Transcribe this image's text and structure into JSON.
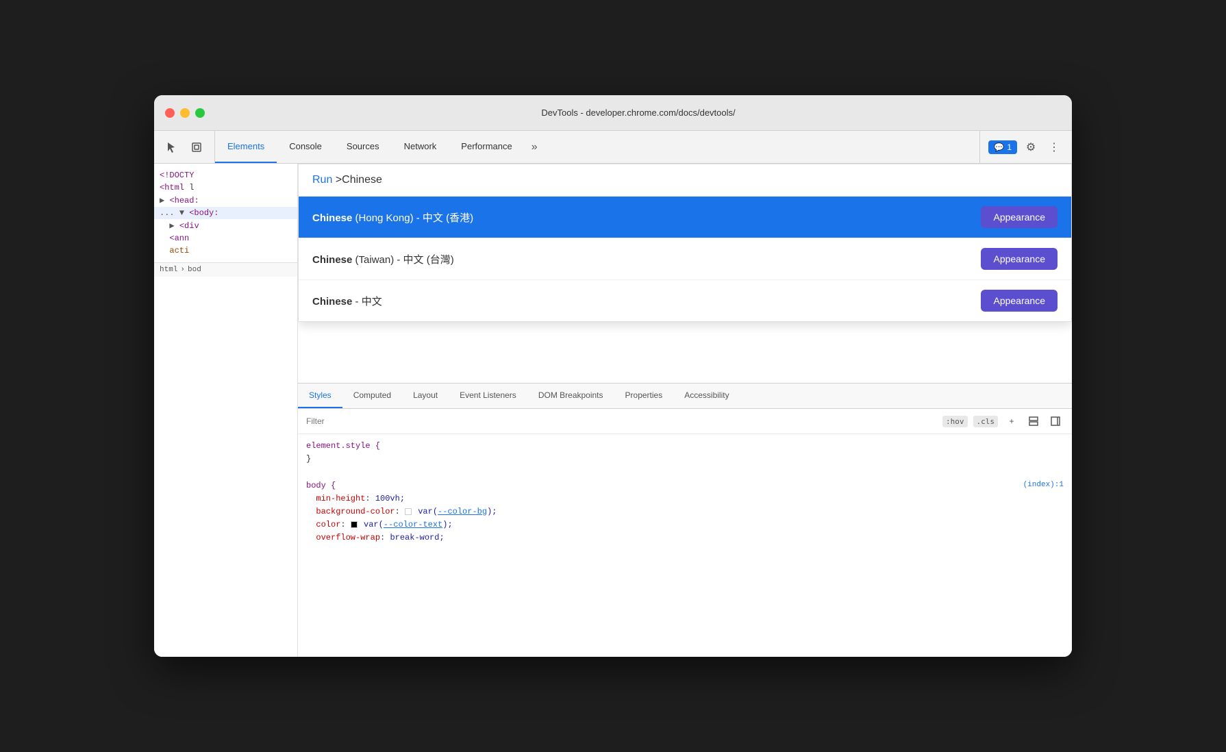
{
  "window": {
    "title": "DevTools - developer.chrome.com/docs/devtools/"
  },
  "toolbar": {
    "tabs": [
      {
        "label": "Elements",
        "active": true
      },
      {
        "label": "Console",
        "active": false
      },
      {
        "label": "Sources",
        "active": false
      },
      {
        "label": "Network",
        "active": false
      },
      {
        "label": "Performance",
        "active": false
      }
    ],
    "more_label": "»",
    "chat_badge": "1",
    "settings_label": "⚙",
    "more_menu_label": "⋮"
  },
  "dom_tree": {
    "lines": [
      {
        "text": "<!DOCTY",
        "type": "doctype"
      },
      {
        "text": "<html l",
        "type": "tag"
      },
      {
        "text": "▶ <head:",
        "type": "tag"
      },
      {
        "text": "... ▼ <body:",
        "type": "tag",
        "selected": true
      },
      {
        "text": "  ▶ <div",
        "type": "tag"
      },
      {
        "text": "  <ann",
        "type": "tag"
      },
      {
        "text": "  acti",
        "type": "attr"
      }
    ]
  },
  "breadcrumb": {
    "items": [
      "html",
      "bod"
    ]
  },
  "dropdown": {
    "search_prefix": "Run",
    "search_text": ">Chinese",
    "items": [
      {
        "label_bold": "Chinese",
        "label_rest": " (Hong Kong) - 中文 (香港)",
        "appearance_label": "Appearance",
        "highlighted": true
      },
      {
        "label_bold": "Chinese",
        "label_rest": " (Taiwan) - 中文 (台灣)",
        "appearance_label": "Appearance",
        "highlighted": false
      },
      {
        "label_bold": "Chinese",
        "label_rest": " - 中文",
        "appearance_label": "Appearance",
        "highlighted": false
      }
    ]
  },
  "styles_panel": {
    "tabs": [
      {
        "label": "Styles",
        "active": true
      },
      {
        "label": "Computed",
        "active": false
      },
      {
        "label": "Layout",
        "active": false
      },
      {
        "label": "Event Listeners",
        "active": false
      },
      {
        "label": "DOM Breakpoints",
        "active": false
      },
      {
        "label": "Properties",
        "active": false
      },
      {
        "label": "Accessibility",
        "active": false
      }
    ],
    "filter_placeholder": "Filter",
    "filter_badges": [
      ":hov",
      ".cls"
    ],
    "css_blocks": [
      {
        "selector": "element.style {",
        "close": "}",
        "props": []
      },
      {
        "selector": "body {",
        "source": "(index):1",
        "close": "}",
        "props": [
          {
            "name": "min-height",
            "value": "100vh;"
          },
          {
            "name": "background-color",
            "swatch": "white",
            "value": "var(--color-bg);"
          },
          {
            "name": "color",
            "swatch": "black",
            "value": "var(--color-text);"
          },
          {
            "name": "overflow-wrap",
            "value": "break-word;"
          }
        ]
      }
    ],
    "var_color_bg": "--color-bg",
    "var_color_text": "--color-text"
  }
}
